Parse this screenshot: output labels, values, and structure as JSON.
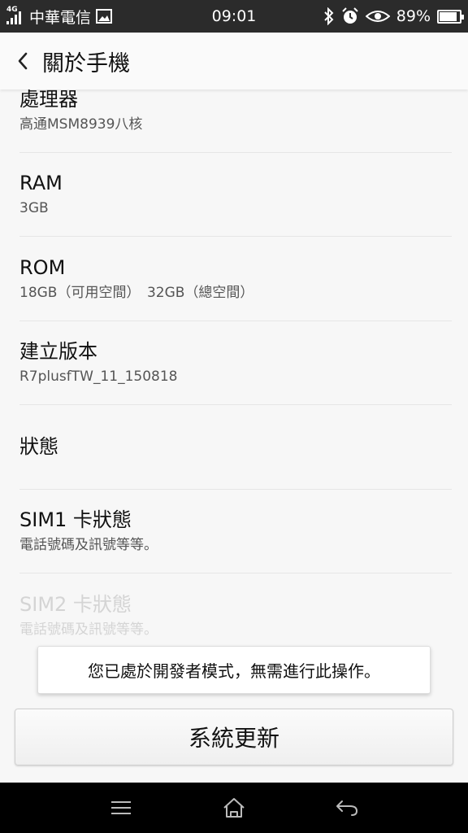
{
  "status_bar": {
    "network": "4G",
    "carrier": "中華電信",
    "time": "09:01",
    "battery": "89%",
    "battery_level": 0.89,
    "icons": [
      "signal-icon",
      "image-icon",
      "bluetooth-icon",
      "alarm-icon",
      "eye-icon",
      "battery-icon"
    ]
  },
  "header": {
    "title": "關於手機",
    "back_icon": "chevron-left-icon"
  },
  "items": [
    {
      "title": "處理器",
      "subtitle": "高通MSM8939八核"
    },
    {
      "title": "RAM",
      "subtitle": "3GB"
    },
    {
      "title": "ROM",
      "subtitle": "18GB（可用空間）　32GB（總空間）"
    },
    {
      "title": "建立版本",
      "subtitle": "R7plusfTW_11_150818"
    },
    {
      "title": "狀態",
      "subtitle": ""
    },
    {
      "title": "SIM1 卡狀態",
      "subtitle": "電話號碼及訊號等等。"
    },
    {
      "title": "SIM2 卡狀態",
      "subtitle": "電話號碼及訊號等等。"
    }
  ],
  "toast": {
    "message": "您已處於開發者模式，無需進行此操作。"
  },
  "update_button": {
    "label": "系統更新"
  },
  "nav_bar": {
    "icons": [
      "menu-icon",
      "home-icon",
      "back-icon"
    ]
  },
  "colors": {
    "status_bar_bg": "#2b2b2b",
    "page_bg": "#f7f7f7",
    "nav_bar_bg": "#000000"
  }
}
